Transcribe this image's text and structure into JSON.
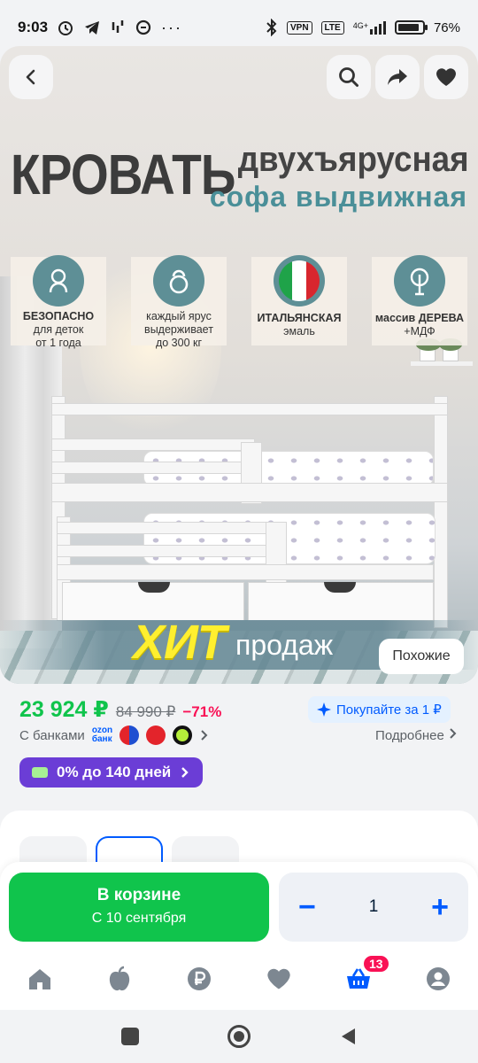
{
  "status_bar": {
    "time": "9:03",
    "vpn_label": "VPN",
    "lte_label": "LTE",
    "network": "4G+",
    "battery_percent": 76,
    "battery_label": "76%"
  },
  "hero": {
    "title_main": "КРОВАТЬ",
    "title_right_1": "двухъярусная",
    "title_right_2": "софа выдвижная",
    "features": [
      {
        "icon": "baby-icon",
        "bold": "БЕЗОПАСНО",
        "text": "для деток",
        "text2": "от 1 года"
      },
      {
        "icon": "kettlebell-icon",
        "bold": "",
        "text": "каждый ярус выдерживает",
        "text2": "до 300 кг"
      },
      {
        "icon": "italy-flag-icon",
        "bold": "ИТАЛЬЯНСКАЯ",
        "text": "эмаль",
        "text2": ""
      },
      {
        "icon": "tree-icon",
        "bold": "массив ДЕРЕВА",
        "text": "+МДФ",
        "text2": ""
      }
    ],
    "hit_big": "ХИТ",
    "hit_small": "продаж",
    "similar_label": "Похожие"
  },
  "price": {
    "current": "23 924 ₽",
    "old": "84 990 ₽",
    "discount": "−71%",
    "buy_for": "Покупайте за 1 ₽",
    "with_banks": "С банками",
    "ozon_bank_line1": "ozon",
    "ozon_bank_line2": "банк",
    "more": "Подробнее",
    "installment": "0% до 140 дней"
  },
  "cart": {
    "in_cart": "В корзине",
    "delivery": "С 10 сентября",
    "minus": "−",
    "plus": "+",
    "quantity": "1"
  },
  "tabbar": {
    "cart_badge": "13"
  },
  "colors": {
    "green": "#10c44c",
    "blue": "#005bff",
    "pink": "#f91155",
    "purple": "#6b3dd6"
  }
}
